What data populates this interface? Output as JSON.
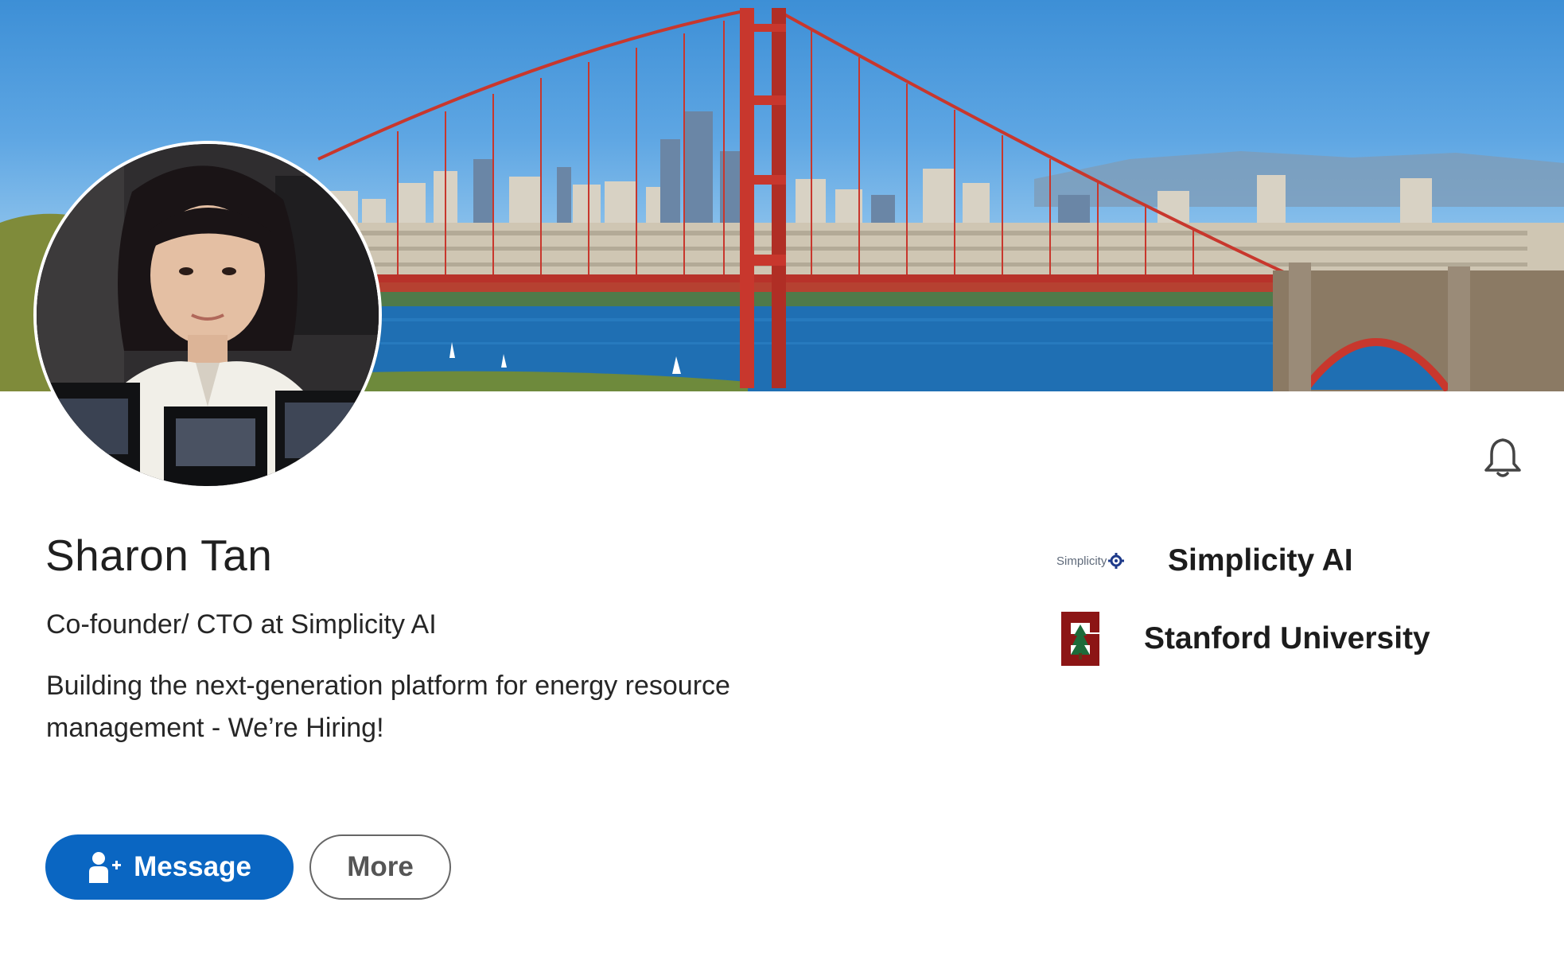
{
  "profile": {
    "name": "Sharon Tan",
    "headline": "Co-founder/ CTO at Simplicity AI",
    "about": "Building the next-generation platform for energy resource management - We’re Hiring!"
  },
  "organizations": [
    {
      "name": "Simplicity AI",
      "logo_text": "Simplicity",
      "logo_icon": "gear-icon"
    },
    {
      "name": "Stanford University",
      "logo_icon": "stanford-tree-logo"
    }
  ],
  "actions": {
    "message_label": "Message",
    "message_icon": "add-person-icon",
    "more_label": "More"
  },
  "notifications": {
    "icon": "bell-icon"
  },
  "colors": {
    "primary_button": "#0a66c2",
    "bridge": "#c8372d",
    "text": "#1f1f1f"
  }
}
